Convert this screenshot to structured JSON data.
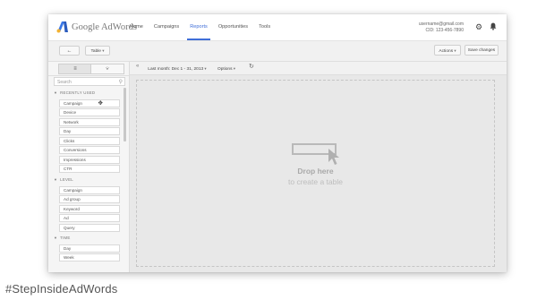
{
  "app": {
    "logo_text": "Google AdWords",
    "nav": [
      "Home",
      "Campaigns",
      "Reports",
      "Opportunities",
      "Tools"
    ],
    "active_nav": "Reports",
    "account_email": "username@gmail.com",
    "account_cid": "CID: 123-456-7890",
    "accent_color": "#3f6ed8"
  },
  "toolbar": {
    "back_label": "←",
    "view_label": "Table",
    "actions_label": "Actions",
    "save_label": "Save changes"
  },
  "left_panel": {
    "tab_columns_icon": "≡",
    "tab_filter_icon": "⩒",
    "search_placeholder": "Search",
    "sections": [
      {
        "title": "RECENTLY USED",
        "items": [
          "Campaign",
          "Device",
          "Network",
          "Day",
          "Clicks",
          "Conversions",
          "Impressions",
          "CTR"
        ]
      },
      {
        "title": "LEVEL",
        "items": [
          "Campaign",
          "Ad group",
          "Keyword",
          "Ad",
          "Query"
        ]
      },
      {
        "title": "TIME",
        "items": [
          "Day",
          "Week"
        ]
      }
    ]
  },
  "report_toolbar": {
    "collapse_icon": "«",
    "date_range": "Last month: Dec 1 - 31, 2013",
    "options_label": "Options",
    "refresh_icon": "↻"
  },
  "dropzone": {
    "title": "Drop here",
    "subtitle": "to create a table"
  },
  "hashtag": "#StepInsideAdWords"
}
